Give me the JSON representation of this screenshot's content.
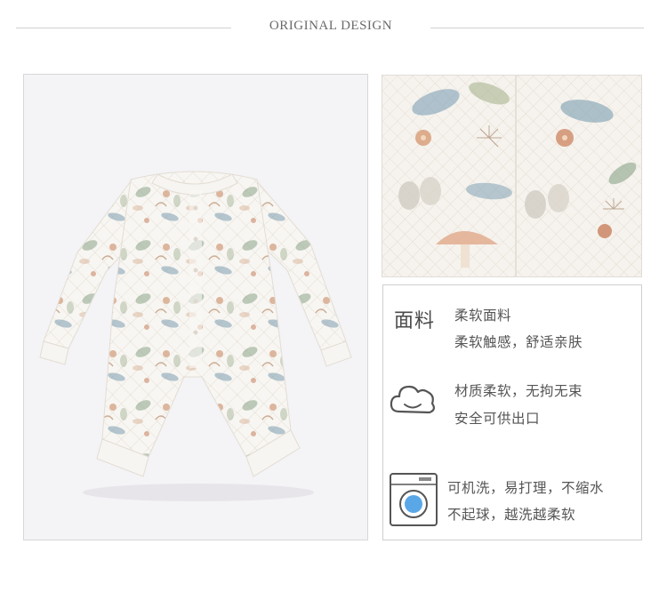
{
  "header": {
    "title": "ORIGINAL DESIGN"
  },
  "features": {
    "fabric": {
      "heading": "面料",
      "line1": "柔软面料",
      "line2": "柔软触感，舒适亲肤"
    },
    "softness": {
      "icon": "cloud-icon",
      "line1": "材质柔软，无拘无束",
      "line2": "安全可供出口"
    },
    "washing": {
      "icon": "washing-machine-icon",
      "line1": "可机洗，易打理，不缩水",
      "line2": "不起球，越洗越柔软"
    }
  },
  "images": {
    "main": "baby-romper-photo",
    "detail": "fabric-closeup-photo"
  },
  "colors": {
    "title": "#6a6a6a",
    "rule": "#d0d0d0",
    "text": "#555555",
    "accent_blue": "#5aa7e8"
  }
}
